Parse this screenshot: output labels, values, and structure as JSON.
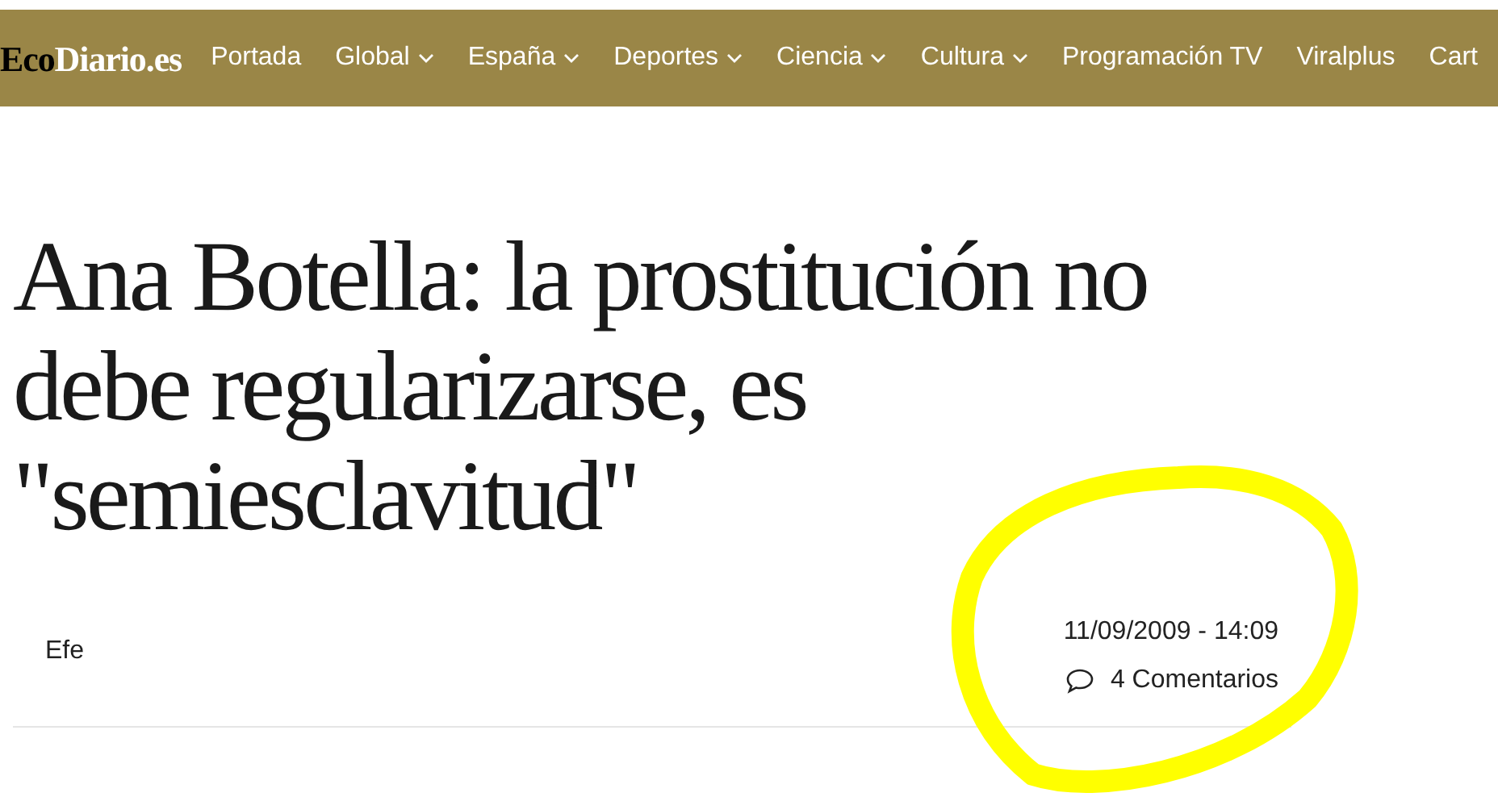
{
  "logo": {
    "lead": "Eco",
    "rest": "Diario.es"
  },
  "nav": [
    {
      "label": "Portada",
      "dropdown": false
    },
    {
      "label": "Global",
      "dropdown": true
    },
    {
      "label": "España",
      "dropdown": true
    },
    {
      "label": "Deportes",
      "dropdown": true
    },
    {
      "label": "Ciencia",
      "dropdown": true
    },
    {
      "label": "Cultura",
      "dropdown": true
    },
    {
      "label": "Programación TV",
      "dropdown": false
    },
    {
      "label": "Viralplus",
      "dropdown": false
    },
    {
      "label": "Cart",
      "dropdown": false
    }
  ],
  "article": {
    "headline": "Ana Botella: la prostitución no debe regularizarse, es \"semiesclavitud\"",
    "author": "Efe",
    "date": "11/09/2009 - 14:09",
    "comments": "4 Comentarios"
  }
}
